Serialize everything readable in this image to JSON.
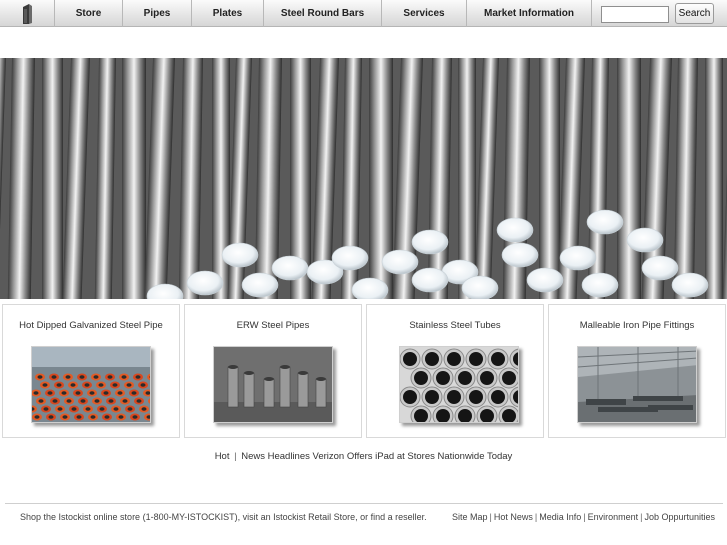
{
  "nav": {
    "logo_icon": "istockist-logo-icon",
    "items": [
      {
        "label": "Store"
      },
      {
        "label": "Pipes"
      },
      {
        "label": "Plates"
      },
      {
        "label": "Steel Round Bars"
      },
      {
        "label": "Services"
      },
      {
        "label": "Market Information"
      }
    ],
    "search": {
      "value": "",
      "placeholder": "",
      "button_label": "Search"
    }
  },
  "hero": {
    "image": "steel-round-bars-photo"
  },
  "products": [
    {
      "title": "Hot Dipped Galvanized Steel Pipe",
      "image": "galvanized-pipe-stack-photo"
    },
    {
      "title": "ERW Steel Pipes",
      "image": "erw-pipes-photo"
    },
    {
      "title": "Stainless Steel Tubes",
      "image": "stainless-tubes-photo"
    },
    {
      "title": "Malleable Iron Pipe Fittings",
      "image": "warehouse-fittings-photo"
    }
  ],
  "headline": {
    "hot_label": "Hot",
    "separator": "|",
    "news_text": "News Headlines Verizon Offers iPad at Stores Nationwide Today"
  },
  "footer": {
    "text": "Shop the Istockist online store (1-800-MY-ISTOCKIST), visit an Istockist Retail Store, or find a reseller.",
    "links": [
      {
        "label": "Site Map"
      },
      {
        "label": "Hot News"
      },
      {
        "label": "Media Info"
      },
      {
        "label": "Environment"
      },
      {
        "label": "Job Oppurtunities"
      }
    ],
    "separator": "|"
  }
}
